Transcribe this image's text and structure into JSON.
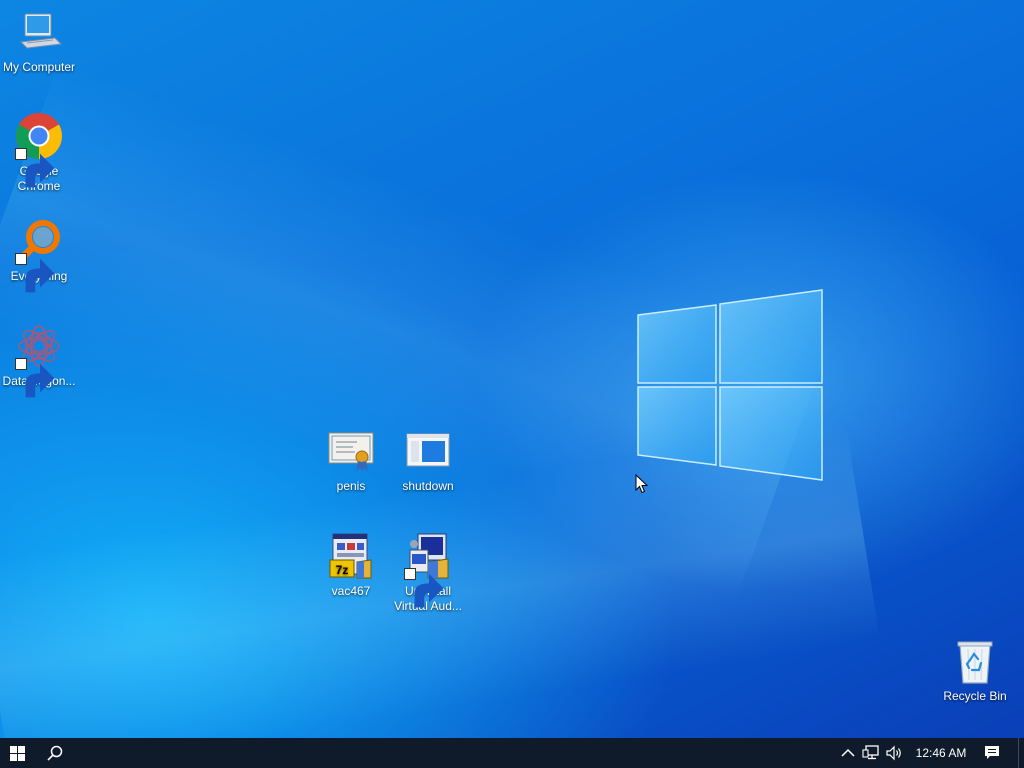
{
  "desktop": {
    "icons": [
      {
        "label": "My Computer",
        "icon": "computer-icon"
      },
      {
        "label": "Google Chrome",
        "icon": "chrome-icon"
      },
      {
        "label": "Everything",
        "icon": "search-magnifier-icon"
      },
      {
        "label": "DataWagon...",
        "icon": "datawagon-icon"
      },
      {
        "label": "penis",
        "icon": "certificate-icon"
      },
      {
        "label": "shutdown",
        "icon": "window-app-icon"
      },
      {
        "label": "vac467",
        "icon": "7z-installer-icon"
      },
      {
        "label": "Uninstall Virtual Aud...",
        "icon": "uninstall-installer-icon"
      },
      {
        "label": "Recycle Bin",
        "icon": "recycle-bin-icon"
      }
    ]
  },
  "taskbar": {
    "clock": "12:46 AM",
    "start_icon": "windows-start-icon",
    "search_icon": "search-icon",
    "tray_icons": [
      "chevron-up-icon",
      "network-icon",
      "volume-icon",
      "notification-icon"
    ]
  },
  "colors": {
    "desktop_blue": "#0a73dc",
    "taskbar": "#0f1a2a"
  }
}
